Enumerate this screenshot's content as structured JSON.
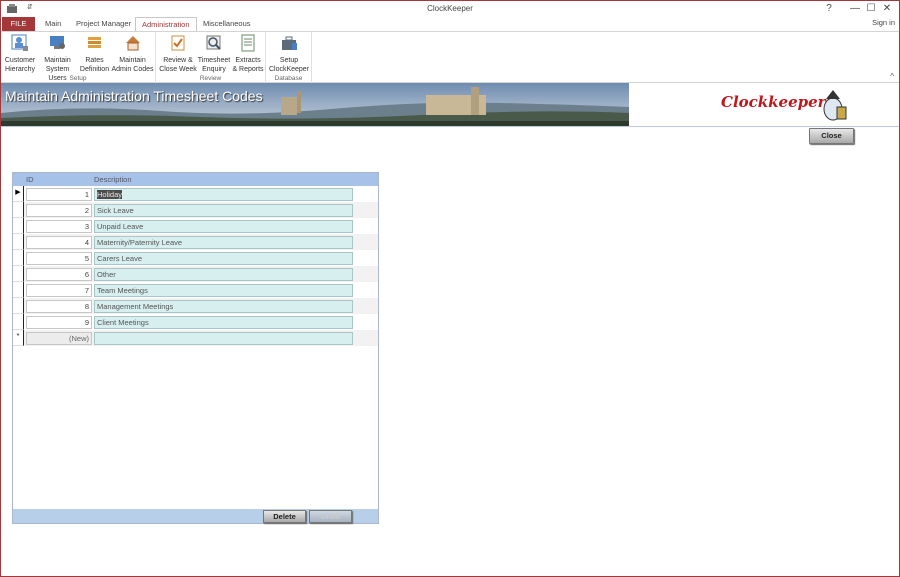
{
  "window": {
    "title": "ClockKeeper",
    "qat": "⇵",
    "help": "?",
    "minimize": "—",
    "maximize": "☐",
    "close": "✕"
  },
  "tabs": [
    {
      "label": "FILE"
    },
    {
      "label": "Main"
    },
    {
      "label": "Project Manager"
    },
    {
      "label": "Administration"
    },
    {
      "label": "Miscellaneous"
    }
  ],
  "signin": "Sign in",
  "ribbon": {
    "setup": {
      "label": "Setup",
      "buttons": [
        {
          "line1": "Customer",
          "line2": "Hierarchy"
        },
        {
          "line1": "Maintain",
          "line2": "System Users"
        },
        {
          "line1": "Rates",
          "line2": "Definition"
        },
        {
          "line1": "Maintain",
          "line2": "Admin Codes"
        }
      ]
    },
    "review": {
      "label": "Review",
      "buttons": [
        {
          "line1": "Review &",
          "line2": "Close Week"
        },
        {
          "line1": "Timesheet",
          "line2": "Enquiry"
        },
        {
          "line1": "Extracts",
          "line2": "& Reports"
        }
      ]
    },
    "database": {
      "label": "Database",
      "buttons": [
        {
          "line1": "Setup",
          "line2": "ClockKeeper"
        }
      ]
    },
    "collapse": "^"
  },
  "banner": {
    "title": "Maintain Administration Timesheet Codes",
    "logo": "Clockkeeper"
  },
  "close_button": "Close",
  "grid": {
    "headers": {
      "id": "ID",
      "description": "Description"
    },
    "rows": [
      {
        "selector": "▶",
        "id": "1",
        "description": "Holiday"
      },
      {
        "selector": "",
        "id": "2",
        "description": "Sick Leave"
      },
      {
        "selector": "",
        "id": "3",
        "description": "Unpaid Leave"
      },
      {
        "selector": "",
        "id": "4",
        "description": "Maternity/Paternity Leave"
      },
      {
        "selector": "",
        "id": "5",
        "description": "Carers Leave"
      },
      {
        "selector": "",
        "id": "6",
        "description": "Other"
      },
      {
        "selector": "",
        "id": "7",
        "description": "Team Meetings"
      },
      {
        "selector": "",
        "id": "8",
        "description": "Management Meetings"
      },
      {
        "selector": "",
        "id": "9",
        "description": "Client Meetings"
      }
    ],
    "new_row": {
      "selector": "*",
      "id": "(New)",
      "description": ""
    }
  },
  "footer": {
    "delete": "Delete",
    "undo": "Undo"
  },
  "colors": {
    "accent": "#a4373a",
    "header": "#a7c2e8",
    "desc_cell": "#d7efef"
  }
}
